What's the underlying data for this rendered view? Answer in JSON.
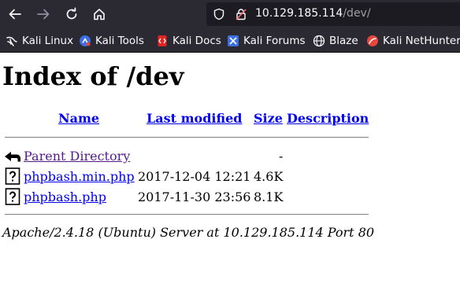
{
  "browser": {
    "url_host": "10.129.185.114",
    "url_path": "/dev/",
    "bookmarks": [
      {
        "label": "Kali Linux",
        "icon": "kali-dragon-icon"
      },
      {
        "label": "Kali Tools",
        "icon": "kali-tools-icon"
      },
      {
        "label": "Kali Docs",
        "icon": "kali-docs-icon"
      },
      {
        "label": "Kali Forums",
        "icon": "kali-forums-icon"
      },
      {
        "label": "Blaze",
        "icon": "globe-icon"
      },
      {
        "label": "Kali NetHunter",
        "icon": "nethunter-icon"
      }
    ],
    "colors": {
      "chrome_bg": "#2b2a33",
      "urlbar_bg": "#1c1b22",
      "text": "#fbfbfe"
    }
  },
  "page": {
    "title": "Index of /dev",
    "columns": {
      "name": "Name",
      "last_modified": "Last modified",
      "size": "Size",
      "description": "Description"
    },
    "rows": [
      {
        "name": "Parent Directory",
        "modified": "",
        "size": "-",
        "icon": "back-folder-icon",
        "visited": true
      },
      {
        "name": "phpbash.min.php",
        "modified": "2017-12-04 12:21",
        "size": "4.6K",
        "icon": "unknown-file-icon",
        "visited": false
      },
      {
        "name": "phpbash.php",
        "modified": "2017-11-30 23:56",
        "size": "8.1K",
        "icon": "unknown-file-icon",
        "visited": false
      }
    ],
    "address": "Apache/2.4.18 (Ubuntu) Server at 10.129.185.114 Port 80",
    "colors": {
      "link": "#0000ee",
      "visited": "#551a8b"
    }
  }
}
